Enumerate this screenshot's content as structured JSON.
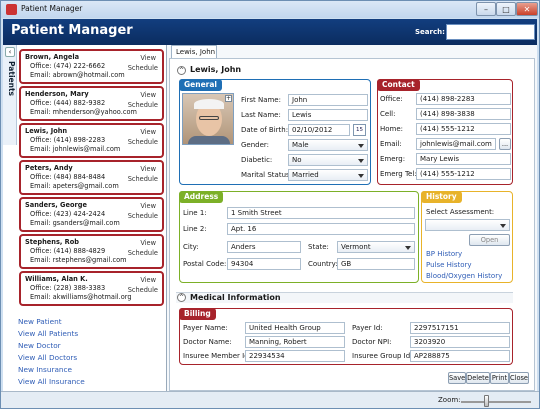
{
  "window": {
    "title": "Patient Manager",
    "min": "–",
    "max": "□",
    "close": "✕"
  },
  "header": {
    "title": "Patient Manager",
    "search_label": "Search:",
    "search_value": ""
  },
  "sidebar": {
    "tab_label": "Patients",
    "collapse_glyph": "‹",
    "cards": [
      {
        "name": "Brown, Angela",
        "office": "Office: (474) 222-6662",
        "email": "Email:  abrown@hotmail.com",
        "view": "View",
        "schedule": "Schedule"
      },
      {
        "name": "Henderson, Mary",
        "office": "Office: (444) 882-9382",
        "email": "Email:  mhenderson@yahoo.com",
        "view": "View",
        "schedule": "Schedule"
      },
      {
        "name": "Lewis, John",
        "office": "Office: (414) 898-2283",
        "email": "Email:  johnlewis@mail.com",
        "view": "View",
        "schedule": "Schedule"
      },
      {
        "name": "Peters, Andy",
        "office": "Office: (484) 884-8484",
        "email": "Email:  apeters@gmail.com",
        "view": "View",
        "schedule": "Schedule"
      },
      {
        "name": "Sanders, George",
        "office": "Office: (423) 424-2424",
        "email": "Email:  gsanders@mail.com",
        "view": "View",
        "schedule": "Schedule"
      },
      {
        "name": "Stephens, Rob",
        "office": "Office: (414) 888-4829",
        "email": "Email:  rstephens@gmail.com",
        "view": "View",
        "schedule": "Schedule"
      },
      {
        "name": "Williams, Alan K.",
        "office": "Office: (228) 388-3383",
        "email": "Email:  akwilliams@hotmail.org",
        "view": "View",
        "schedule": "Schedule"
      }
    ],
    "links": [
      "New Patient",
      "View All Patients",
      "New Doctor",
      "View All Doctors",
      "New Insurance",
      "View All Insurance"
    ]
  },
  "main": {
    "tab": "Lewis, John",
    "patient_heading": "Lewis, John",
    "general": {
      "title": "General",
      "first_name_label": "First Name:",
      "first_name": "John",
      "last_name_label": "Last Name:",
      "last_name": "Lewis",
      "dob_label": "Date of Birth:",
      "dob": "02/10/2012",
      "calendar_glyph": "15",
      "photo_add_glyph": "+",
      "gender_label": "Gender:",
      "gender": "Male",
      "diabetic_label": "Diabetic:",
      "diabetic": "No",
      "marital_label": "Marital Status:",
      "marital": "Married"
    },
    "contact": {
      "title": "Contact",
      "office_label": "Office:",
      "office": "(414) 898-2283",
      "cell_label": "Cell:",
      "cell": "(414) 898-3838",
      "home_label": "Home:",
      "home": "(414) 555-1212",
      "email_label": "Email:",
      "email": "johnlewis@mail.com",
      "email_btn": "...",
      "emerg_label": "Emerg:",
      "emerg": "Mary Lewis",
      "emerg_tel_label": "Emerg Tel:",
      "emerg_tel": "(414) 555-1212"
    },
    "address": {
      "title": "Address",
      "line1_label": "Line 1:",
      "line1": "1 Smith Street",
      "line2_label": "Line 2:",
      "line2": "Apt. 16",
      "city_label": "City:",
      "city": "Anders",
      "state_label": "State:",
      "state": "Vermont",
      "postal_label": "Postal Code:",
      "postal": "94304",
      "country_label": "Country:",
      "country": "GB"
    },
    "history": {
      "title": "History",
      "select_label": "Select Assessment:",
      "open_btn": "Open",
      "links": [
        "BP History",
        "Pulse History",
        "Blood/Oxygen History"
      ]
    },
    "medical_heading": "Medical Information",
    "billing": {
      "title": "Billing",
      "payer_name_label": "Payer Name:",
      "payer_name": "United Health Group",
      "payer_id_label": "Payer Id:",
      "payer_id": "2297517151",
      "doctor_name_label": "Doctor Name:",
      "doctor_name": "Manning, Robert",
      "doctor_npi_label": "Doctor NPI:",
      "doctor_npi": "3203920",
      "member_id_label": "Insuree Member Id:",
      "member_id": "22934534",
      "group_id_label": "Insuree Group Id:",
      "group_id": "AP288875"
    },
    "actions": [
      "Save",
      "Delete",
      "Print",
      "Close"
    ]
  },
  "status": {
    "zoom_label": "Zoom:"
  },
  "colors": {
    "header_blue": "#0b2c5f",
    "general_blue": "#1f6fb5",
    "contact_red": "#a7232b",
    "address_green": "#7cb028",
    "history_gold": "#e8b32a",
    "billing_red": "#a7232b"
  }
}
